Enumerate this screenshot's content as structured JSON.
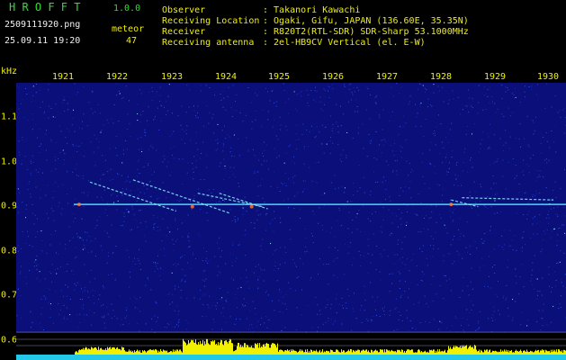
{
  "app": {
    "name": "H R O F F T",
    "version": "1.0.0"
  },
  "file": {
    "name": "2509111920.png",
    "datetime": "25.09.11 19:20"
  },
  "meteor": {
    "label": "meteor",
    "count": "47"
  },
  "info": [
    {
      "label": "Observer",
      "value": ": Takanori Kawachi"
    },
    {
      "label": "Receiving Location",
      "value": ": Ogaki, Gifu, JAPAN (136.60E, 35.35N)"
    },
    {
      "label": "Receiver",
      "value": ": R820T2(RTL-SDR) SDR-Sharp 53.1000MHz"
    },
    {
      "label": "Receiving antenna",
      "value": ": 2el-HB9CV Vertical (el. E-W)"
    }
  ],
  "yaxis_unit": "kHz",
  "chart_data": {
    "type": "heatmap",
    "title": "",
    "xlabel": "",
    "ylabel": "kHz",
    "x_ticks": [
      "1921",
      "1922",
      "1923",
      "1924",
      "1925",
      "1926",
      "1927",
      "1928",
      "1929",
      "1930"
    ],
    "y_ticks": [
      "1.1",
      "1.0",
      "0.9",
      "0.8",
      "0.7",
      "0.6"
    ],
    "x_range": [
      1920.6,
      1930.1
    ],
    "y_range": [
      0.58,
      1.17
    ],
    "carrier_frequency_khz": 0.905,
    "meteor_traces": [
      {
        "x": [
          1921.5,
          1923.1
        ],
        "y": [
          0.955,
          0.89
        ]
      },
      {
        "x": [
          1922.3,
          1924.1
        ],
        "y": [
          0.96,
          0.885
        ]
      },
      {
        "x": [
          1923.5,
          1924.7
        ],
        "y": [
          0.93,
          0.9
        ]
      },
      {
        "x": [
          1923.9,
          1924.8
        ],
        "y": [
          0.93,
          0.895
        ]
      },
      {
        "x": [
          1928.2,
          1928.7
        ],
        "y": [
          0.915,
          0.9
        ]
      },
      {
        "x": [
          1928.4,
          1930.1
        ],
        "y": [
          0.92,
          0.915
        ]
      }
    ],
    "colors": {
      "noise_bg": "#0a0f7a",
      "carrier": "#4ff0ff",
      "trace": "#8af0ff",
      "bars": "#f0f000",
      "axis": "#f0f000"
    }
  }
}
